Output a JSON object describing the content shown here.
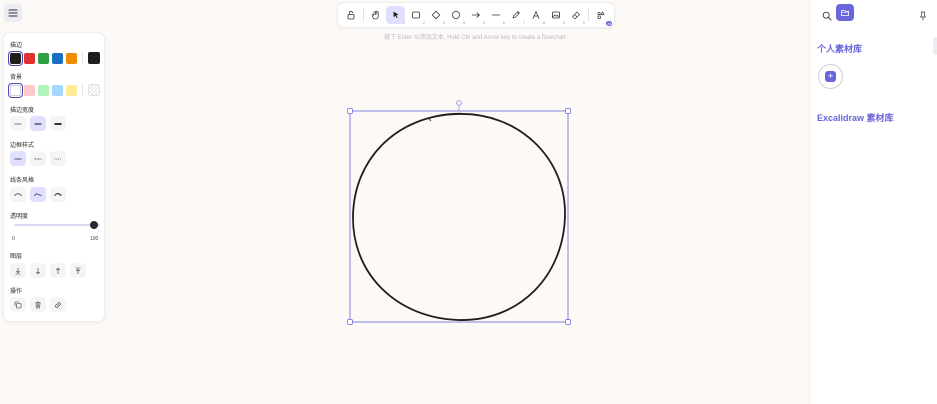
{
  "toolbar": {
    "tools": [
      {
        "id": "lock",
        "icon": "lock-icon",
        "key": ""
      },
      {
        "id": "hand",
        "icon": "hand-icon",
        "key": ""
      },
      {
        "id": "selection",
        "icon": "pointer-icon",
        "key": "1",
        "active": true
      },
      {
        "id": "rectangle",
        "icon": "rectangle-icon",
        "key": "2"
      },
      {
        "id": "diamond",
        "icon": "diamond-icon",
        "key": "3"
      },
      {
        "id": "ellipse",
        "icon": "ellipse-icon",
        "key": "4"
      },
      {
        "id": "arrow",
        "icon": "arrow-icon",
        "key": "5"
      },
      {
        "id": "line",
        "icon": "line-icon",
        "key": "6"
      },
      {
        "id": "draw",
        "icon": "pencil-icon",
        "key": "7"
      },
      {
        "id": "text",
        "icon": "text-icon",
        "key": "8"
      },
      {
        "id": "image",
        "icon": "image-icon",
        "key": "9"
      },
      {
        "id": "eraser",
        "icon": "eraser-icon",
        "key": "0"
      },
      {
        "id": "more",
        "icon": "more-tools-icon",
        "key": "",
        "badge": "AI"
      }
    ]
  },
  "hint": "按下 Enter 以添加文本, Hold Ctrl and Arrow key to create a flowchart",
  "props": {
    "stroke_title": "描边",
    "stroke_colors": [
      "#1e1e1e",
      "#e03131",
      "#2f9e44",
      "#1971c2",
      "#f08c00"
    ],
    "stroke_current": "#1e1e1e",
    "background_title": "背景",
    "background_colors": [
      "transparent",
      "#ffc9c9",
      "#b2f2bb",
      "#a5d8ff",
      "#ffec99"
    ],
    "background_current": "transparent",
    "stroke_width_title": "描边宽度",
    "stroke_style_title": "边框样式",
    "sloppiness_title": "线条风格",
    "opacity_title": "透明度",
    "opacity_min": "0",
    "opacity_max": "100",
    "opacity_value": 100,
    "layers_title": "图层",
    "actions_title": "操作"
  },
  "library": {
    "personal_title": "个人素材库",
    "excalidraw_title": "Excalidraw 素材库",
    "add_label": "+"
  },
  "colors": {
    "accent": "#6965db",
    "selection": "#6965db"
  }
}
